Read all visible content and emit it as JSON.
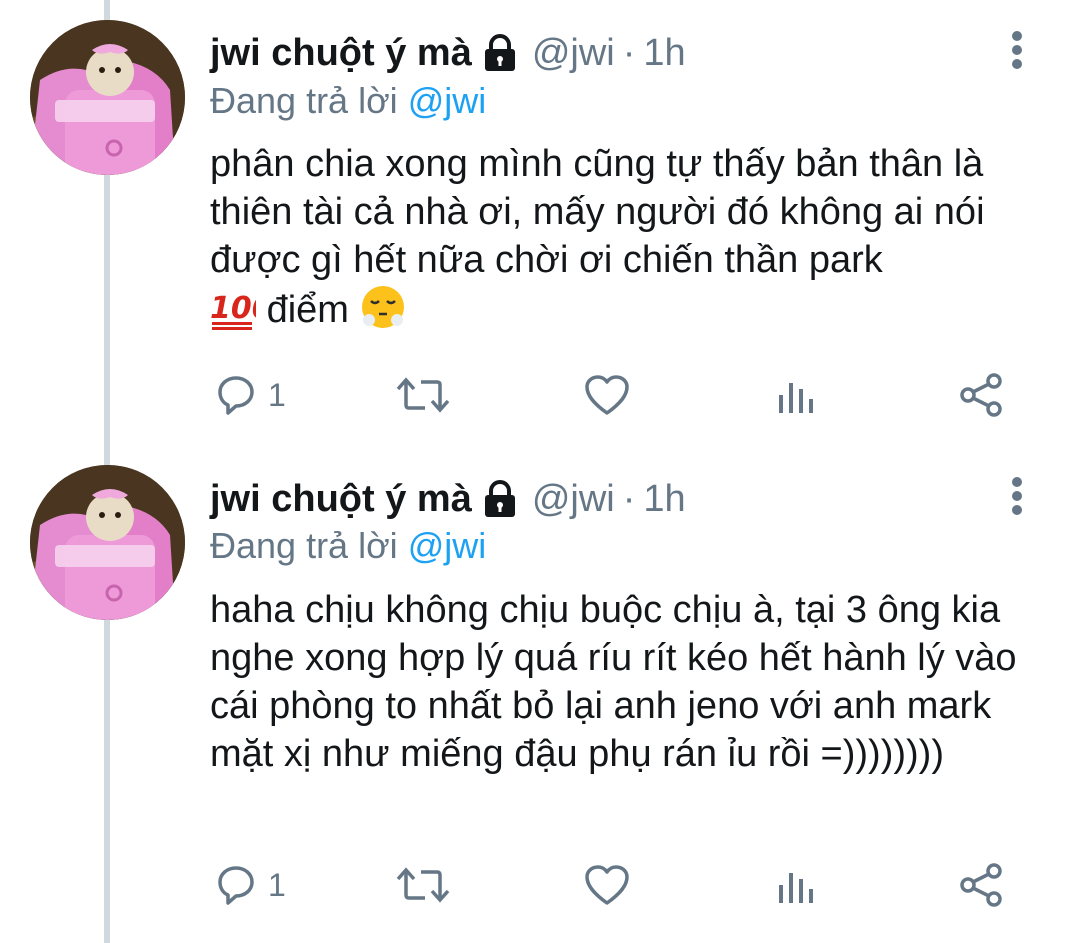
{
  "tweets": [
    {
      "display_name": "jwi chuột ý mà",
      "handle": "@jwi",
      "separator": "·",
      "time": "1h",
      "reply_prefix": "Đang trả lời",
      "reply_to": "@jwi",
      "text": "phân chia xong mình cũng tự thấy bản thân là thiên tài cả nhà ơi, mấy người đó không ai nói được gì hết nữa chời ơi chiến thần park",
      "text_suffix": "điểm",
      "emojis": [
        "hundred-points-emoji",
        "face-with-steam-emoji"
      ],
      "reply_count": "1"
    },
    {
      "display_name": "jwi chuột ý mà",
      "handle": "@jwi",
      "separator": "·",
      "time": "1h",
      "reply_prefix": "Đang trả lời",
      "reply_to": "@jwi",
      "text": "haha chịu không chịu buộc chịu à, tại 3 ông kia nghe xong hợp lý quá ríu rít kéo hết hành lý vào cái phòng to nhất bỏ lại anh jeno với anh mark mặt xị như miếng đậu phụ rán ỉu rồi =))))))))",
      "reply_count": "1"
    }
  ],
  "icons": {
    "lock": "lock-icon",
    "more": "more-vertical-icon",
    "reply": "reply-icon",
    "retweet": "retweet-icon",
    "like": "heart-icon",
    "analytics": "analytics-icon",
    "share": "share-icon"
  },
  "colors": {
    "text": "#14171a",
    "secondary": "#657786",
    "link": "#1da1f2",
    "thread_line": "#cfd9de"
  }
}
